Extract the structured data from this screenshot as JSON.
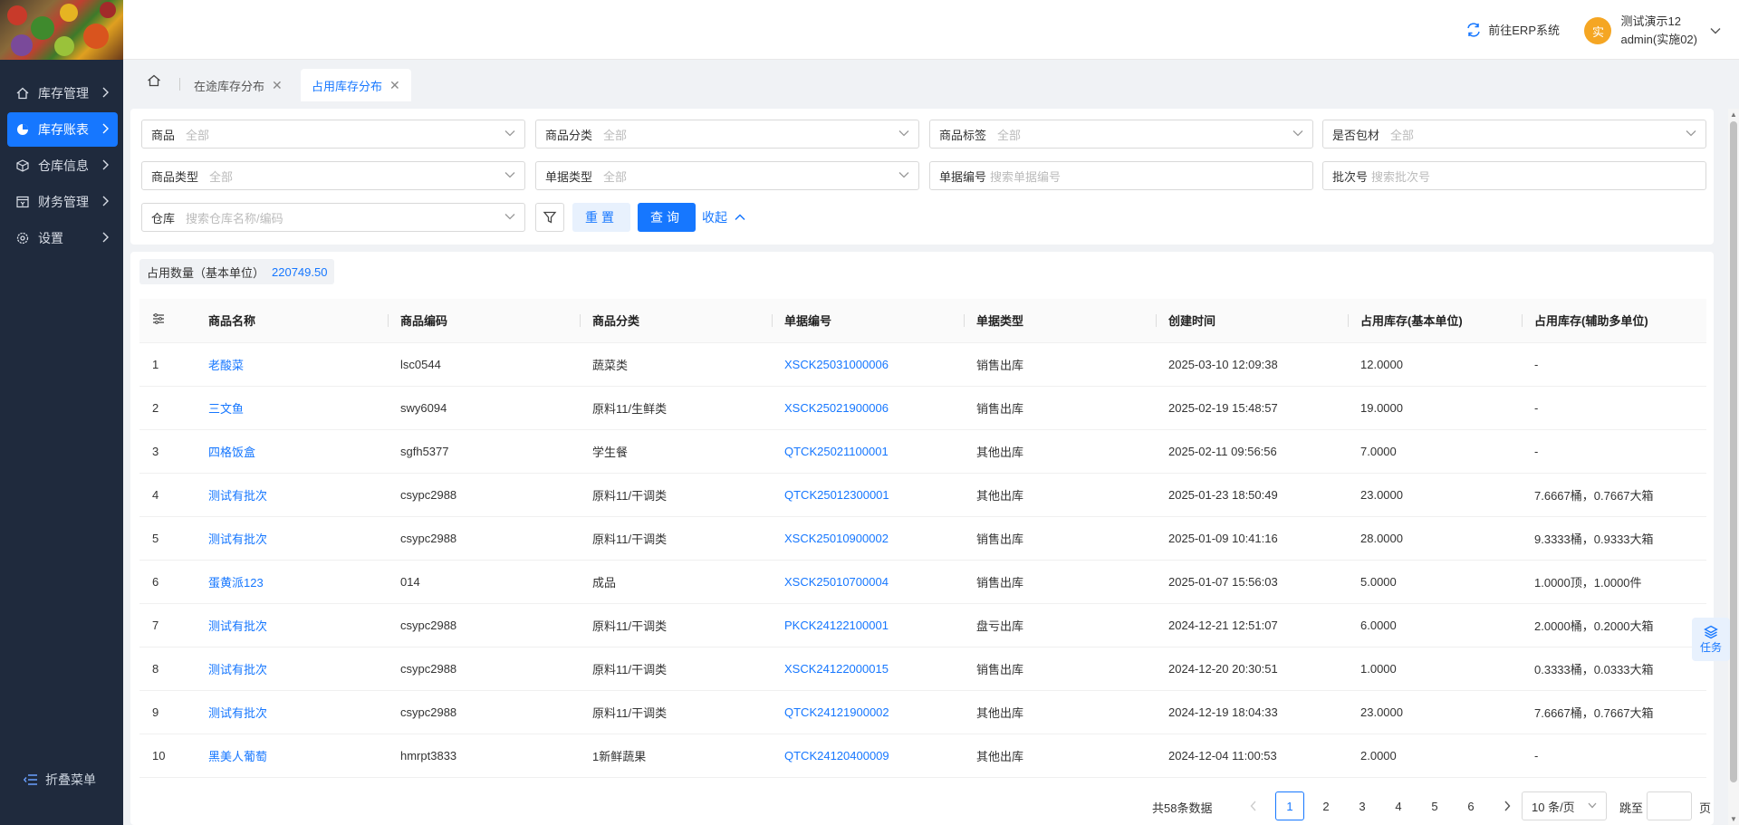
{
  "sidebar": {
    "items": [
      {
        "label": "库存管理",
        "icon": "home-icon"
      },
      {
        "label": "库存账表",
        "icon": "pie-chart-icon"
      },
      {
        "label": "仓库信息",
        "icon": "cube-icon"
      },
      {
        "label": "财务管理",
        "icon": "finance-icon"
      },
      {
        "label": "设置",
        "icon": "gear-icon"
      }
    ],
    "active_index": 1,
    "collapse_label": "折叠菜单"
  },
  "header": {
    "erp_link": "前往ERP系统",
    "avatar_text": "实",
    "user_name": "测试演示12",
    "user_account": "admin(实施02)"
  },
  "tabs": [
    {
      "label": "在途库存分布",
      "active": false
    },
    {
      "label": "占用库存分布",
      "active": true
    }
  ],
  "filters": {
    "product": {
      "label": "商品",
      "placeholder": "全部"
    },
    "category": {
      "label": "商品分类",
      "placeholder": "全部"
    },
    "tag": {
      "label": "商品标签",
      "placeholder": "全部"
    },
    "packaging": {
      "label": "是否包材",
      "placeholder": "全部"
    },
    "product_type": {
      "label": "商品类型",
      "placeholder": "全部"
    },
    "doc_type": {
      "label": "单据类型",
      "placeholder": "全部"
    },
    "doc_no": {
      "label": "单据编号",
      "placeholder": "搜索单据编号"
    },
    "batch_no": {
      "label": "批次号",
      "placeholder": "搜索批次号"
    },
    "warehouse": {
      "label": "仓库",
      "placeholder": "搜索仓库名称/编码"
    },
    "reset": "重置",
    "query": "查询",
    "fold": "收起"
  },
  "summary": {
    "label": "占用数量（基本单位）",
    "value": "220749.50"
  },
  "table": {
    "columns": [
      "商品名称",
      "商品编码",
      "商品分类",
      "单据编号",
      "单据类型",
      "创建时间",
      "占用库存(基本单位)",
      "占用库存(辅助多单位)"
    ],
    "rows": [
      [
        "1",
        "老酸菜",
        "lsc0544",
        "蔬菜类",
        "XSCK25031000006",
        "销售出库",
        "2025-03-10 12:09:38",
        "12.0000",
        "-"
      ],
      [
        "2",
        "三文鱼",
        "swy6094",
        "原料11/生鲜类",
        "XSCK25021900006",
        "销售出库",
        "2025-02-19 15:48:57",
        "19.0000",
        "-"
      ],
      [
        "3",
        "四格饭盒",
        "sgfh5377",
        "学生餐",
        "QTCK25021100001",
        "其他出库",
        "2025-02-11 09:56:56",
        "7.0000",
        "-"
      ],
      [
        "4",
        "测试有批次",
        "csypc2988",
        "原料11/干调类",
        "QTCK25012300001",
        "其他出库",
        "2025-01-23 18:50:49",
        "23.0000",
        "7.6667桶，0.7667大箱"
      ],
      [
        "5",
        "测试有批次",
        "csypc2988",
        "原料11/干调类",
        "XSCK25010900002",
        "销售出库",
        "2025-01-09 10:41:16",
        "28.0000",
        "9.3333桶，0.9333大箱"
      ],
      [
        "6",
        "蛋黄派123",
        "014",
        "成品",
        "XSCK25010700004",
        "销售出库",
        "2025-01-07 15:56:03",
        "5.0000",
        "1.0000顶，1.0000件"
      ],
      [
        "7",
        "测试有批次",
        "csypc2988",
        "原料11/干调类",
        "PKCK24122100001",
        "盘亏出库",
        "2024-12-21 12:51:07",
        "6.0000",
        "2.0000桶，0.2000大箱"
      ],
      [
        "8",
        "测试有批次",
        "csypc2988",
        "原料11/干调类",
        "XSCK24122000015",
        "销售出库",
        "2024-12-20 20:30:51",
        "1.0000",
        "0.3333桶，0.0333大箱"
      ],
      [
        "9",
        "测试有批次",
        "csypc2988",
        "原料11/干调类",
        "QTCK24121900002",
        "其他出库",
        "2024-12-19 18:04:33",
        "23.0000",
        "7.6667桶，0.7667大箱"
      ],
      [
        "10",
        "黑美人葡萄",
        "hmrpt3833",
        "1新鲜蔬果",
        "QTCK24120400009",
        "其他出库",
        "2024-12-04 11:00:53",
        "2.0000",
        "-"
      ]
    ]
  },
  "pagination": {
    "total": "共58条数据",
    "pages": [
      "1",
      "2",
      "3",
      "4",
      "5",
      "6"
    ],
    "current": "1",
    "page_size": "10 条/页",
    "jump_label": "跳至",
    "jump_unit": "页"
  },
  "task": {
    "label": "任务"
  },
  "colors": {
    "primary": "#1677ff",
    "sidebar_bg": "#1f2a3d",
    "avatar": "#f5a623"
  }
}
